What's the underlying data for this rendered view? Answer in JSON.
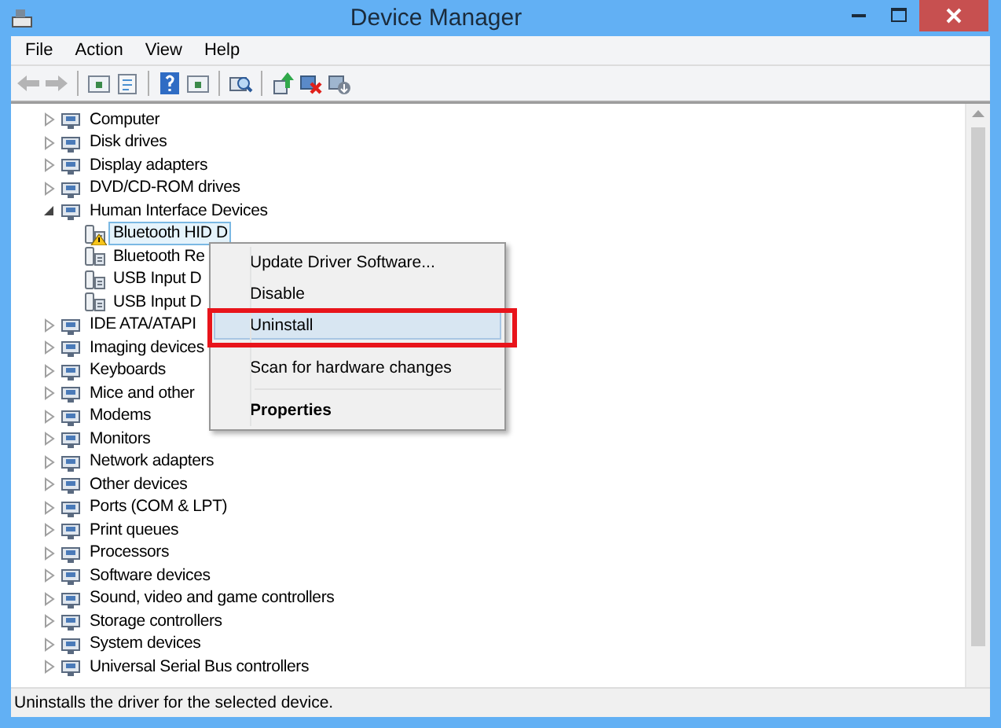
{
  "window": {
    "title": "Device Manager"
  },
  "menu_bar": [
    "File",
    "Action",
    "View",
    "Help"
  ],
  "toolbar": [
    {
      "kind": "back",
      "disabled": true
    },
    {
      "kind": "forward",
      "disabled": true
    },
    {
      "kind": "separator"
    },
    {
      "kind": "panel"
    },
    {
      "kind": "properties"
    },
    {
      "kind": "separator"
    },
    {
      "kind": "help"
    },
    {
      "kind": "panel"
    },
    {
      "kind": "separator"
    },
    {
      "kind": "scan"
    },
    {
      "kind": "separator"
    },
    {
      "kind": "update"
    },
    {
      "kind": "uninstall"
    },
    {
      "kind": "enable"
    }
  ],
  "tree": [
    {
      "label": "Computer",
      "expanded": false
    },
    {
      "label": "Disk drives",
      "expanded": false
    },
    {
      "label": "Display adapters",
      "expanded": false
    },
    {
      "label": "DVD/CD-ROM drives",
      "expanded": false
    },
    {
      "label": "Human Interface Devices",
      "expanded": true,
      "children": [
        {
          "label": "Bluetooth HID D",
          "selected": true,
          "warning": true
        },
        {
          "label": "Bluetooth Re",
          "selected": false,
          "warning": false
        },
        {
          "label": "USB Input D",
          "selected": false,
          "warning": false
        },
        {
          "label": "USB Input D",
          "selected": false,
          "warning": false
        }
      ]
    },
    {
      "label": "IDE ATA/ATAPI",
      "expanded": false
    },
    {
      "label": "Imaging devices",
      "expanded": false
    },
    {
      "label": "Keyboards",
      "expanded": false
    },
    {
      "label": "Mice and other",
      "expanded": false
    },
    {
      "label": "Modems",
      "expanded": false
    },
    {
      "label": "Monitors",
      "expanded": false
    },
    {
      "label": "Network adapters",
      "expanded": false
    },
    {
      "label": "Other devices",
      "expanded": false
    },
    {
      "label": "Ports (COM & LPT)",
      "expanded": false
    },
    {
      "label": "Print queues",
      "expanded": false
    },
    {
      "label": "Processors",
      "expanded": false
    },
    {
      "label": "Software devices",
      "expanded": false
    },
    {
      "label": "Sound, video and game controllers",
      "expanded": false
    },
    {
      "label": "Storage controllers",
      "expanded": false
    },
    {
      "label": "System devices",
      "expanded": false
    },
    {
      "label": "Universal Serial Bus controllers",
      "expanded": false
    }
  ],
  "context_menu": [
    {
      "kind": "item",
      "label": "Update Driver Software...",
      "selected": false,
      "bold": false
    },
    {
      "kind": "item",
      "label": "Disable",
      "selected": false,
      "bold": false
    },
    {
      "kind": "item",
      "label": "Uninstall",
      "selected": true,
      "bold": false
    },
    {
      "kind": "separator"
    },
    {
      "kind": "item",
      "label": "Scan for hardware changes",
      "selected": false,
      "bold": false
    },
    {
      "kind": "separator"
    },
    {
      "kind": "item",
      "label": "Properties",
      "selected": false,
      "bold": true
    }
  ],
  "highlight_frame": {
    "around_selected": true
  },
  "status_bar": "Uninstalls the driver for the selected device."
}
